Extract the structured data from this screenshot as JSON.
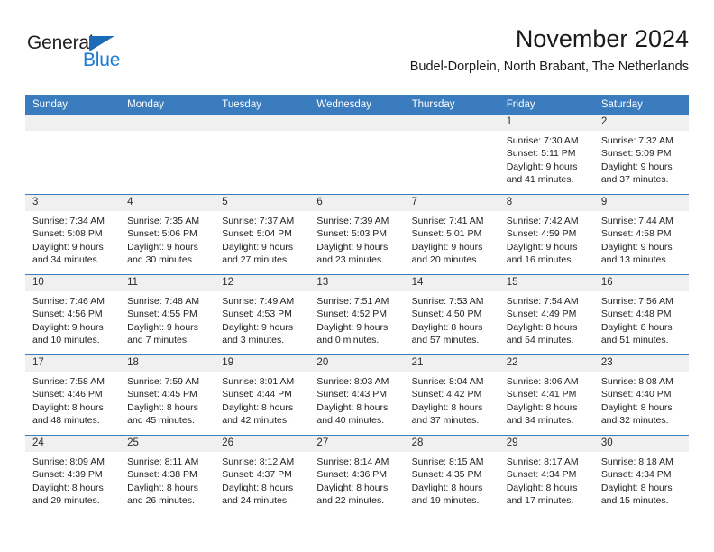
{
  "logo": {
    "word_top": "General",
    "word_bottom": "Blue",
    "triangle_icon": "blue-triangle-icon",
    "color_dark": "#231f20",
    "color_blue": "#1b7ad4"
  },
  "header": {
    "title": "November 2024",
    "subtitle": "Budel-Dorplein, North Brabant, The Netherlands"
  },
  "theme": {
    "header_row_bg": "#3a7cbe",
    "header_row_text": "#ffffff",
    "daynum_band_bg": "#f0f0f0",
    "row_divider": "#3a7cbe"
  },
  "calendar": {
    "weekday_headers": [
      "Sunday",
      "Monday",
      "Tuesday",
      "Wednesday",
      "Thursday",
      "Friday",
      "Saturday"
    ],
    "weeks": [
      [
        {
          "day": "",
          "lines": []
        },
        {
          "day": "",
          "lines": []
        },
        {
          "day": "",
          "lines": []
        },
        {
          "day": "",
          "lines": []
        },
        {
          "day": "",
          "lines": []
        },
        {
          "day": "1",
          "lines": [
            "Sunrise: 7:30 AM",
            "Sunset: 5:11 PM",
            "Daylight: 9 hours",
            "and 41 minutes."
          ]
        },
        {
          "day": "2",
          "lines": [
            "Sunrise: 7:32 AM",
            "Sunset: 5:09 PM",
            "Daylight: 9 hours",
            "and 37 minutes."
          ]
        }
      ],
      [
        {
          "day": "3",
          "lines": [
            "Sunrise: 7:34 AM",
            "Sunset: 5:08 PM",
            "Daylight: 9 hours",
            "and 34 minutes."
          ]
        },
        {
          "day": "4",
          "lines": [
            "Sunrise: 7:35 AM",
            "Sunset: 5:06 PM",
            "Daylight: 9 hours",
            "and 30 minutes."
          ]
        },
        {
          "day": "5",
          "lines": [
            "Sunrise: 7:37 AM",
            "Sunset: 5:04 PM",
            "Daylight: 9 hours",
            "and 27 minutes."
          ]
        },
        {
          "day": "6",
          "lines": [
            "Sunrise: 7:39 AM",
            "Sunset: 5:03 PM",
            "Daylight: 9 hours",
            "and 23 minutes."
          ]
        },
        {
          "day": "7",
          "lines": [
            "Sunrise: 7:41 AM",
            "Sunset: 5:01 PM",
            "Daylight: 9 hours",
            "and 20 minutes."
          ]
        },
        {
          "day": "8",
          "lines": [
            "Sunrise: 7:42 AM",
            "Sunset: 4:59 PM",
            "Daylight: 9 hours",
            "and 16 minutes."
          ]
        },
        {
          "day": "9",
          "lines": [
            "Sunrise: 7:44 AM",
            "Sunset: 4:58 PM",
            "Daylight: 9 hours",
            "and 13 minutes."
          ]
        }
      ],
      [
        {
          "day": "10",
          "lines": [
            "Sunrise: 7:46 AM",
            "Sunset: 4:56 PM",
            "Daylight: 9 hours",
            "and 10 minutes."
          ]
        },
        {
          "day": "11",
          "lines": [
            "Sunrise: 7:48 AM",
            "Sunset: 4:55 PM",
            "Daylight: 9 hours",
            "and 7 minutes."
          ]
        },
        {
          "day": "12",
          "lines": [
            "Sunrise: 7:49 AM",
            "Sunset: 4:53 PM",
            "Daylight: 9 hours",
            "and 3 minutes."
          ]
        },
        {
          "day": "13",
          "lines": [
            "Sunrise: 7:51 AM",
            "Sunset: 4:52 PM",
            "Daylight: 9 hours",
            "and 0 minutes."
          ]
        },
        {
          "day": "14",
          "lines": [
            "Sunrise: 7:53 AM",
            "Sunset: 4:50 PM",
            "Daylight: 8 hours",
            "and 57 minutes."
          ]
        },
        {
          "day": "15",
          "lines": [
            "Sunrise: 7:54 AM",
            "Sunset: 4:49 PM",
            "Daylight: 8 hours",
            "and 54 minutes."
          ]
        },
        {
          "day": "16",
          "lines": [
            "Sunrise: 7:56 AM",
            "Sunset: 4:48 PM",
            "Daylight: 8 hours",
            "and 51 minutes."
          ]
        }
      ],
      [
        {
          "day": "17",
          "lines": [
            "Sunrise: 7:58 AM",
            "Sunset: 4:46 PM",
            "Daylight: 8 hours",
            "and 48 minutes."
          ]
        },
        {
          "day": "18",
          "lines": [
            "Sunrise: 7:59 AM",
            "Sunset: 4:45 PM",
            "Daylight: 8 hours",
            "and 45 minutes."
          ]
        },
        {
          "day": "19",
          "lines": [
            "Sunrise: 8:01 AM",
            "Sunset: 4:44 PM",
            "Daylight: 8 hours",
            "and 42 minutes."
          ]
        },
        {
          "day": "20",
          "lines": [
            "Sunrise: 8:03 AM",
            "Sunset: 4:43 PM",
            "Daylight: 8 hours",
            "and 40 minutes."
          ]
        },
        {
          "day": "21",
          "lines": [
            "Sunrise: 8:04 AM",
            "Sunset: 4:42 PM",
            "Daylight: 8 hours",
            "and 37 minutes."
          ]
        },
        {
          "day": "22",
          "lines": [
            "Sunrise: 8:06 AM",
            "Sunset: 4:41 PM",
            "Daylight: 8 hours",
            "and 34 minutes."
          ]
        },
        {
          "day": "23",
          "lines": [
            "Sunrise: 8:08 AM",
            "Sunset: 4:40 PM",
            "Daylight: 8 hours",
            "and 32 minutes."
          ]
        }
      ],
      [
        {
          "day": "24",
          "lines": [
            "Sunrise: 8:09 AM",
            "Sunset: 4:39 PM",
            "Daylight: 8 hours",
            "and 29 minutes."
          ]
        },
        {
          "day": "25",
          "lines": [
            "Sunrise: 8:11 AM",
            "Sunset: 4:38 PM",
            "Daylight: 8 hours",
            "and 26 minutes."
          ]
        },
        {
          "day": "26",
          "lines": [
            "Sunrise: 8:12 AM",
            "Sunset: 4:37 PM",
            "Daylight: 8 hours",
            "and 24 minutes."
          ]
        },
        {
          "day": "27",
          "lines": [
            "Sunrise: 8:14 AM",
            "Sunset: 4:36 PM",
            "Daylight: 8 hours",
            "and 22 minutes."
          ]
        },
        {
          "day": "28",
          "lines": [
            "Sunrise: 8:15 AM",
            "Sunset: 4:35 PM",
            "Daylight: 8 hours",
            "and 19 minutes."
          ]
        },
        {
          "day": "29",
          "lines": [
            "Sunrise: 8:17 AM",
            "Sunset: 4:34 PM",
            "Daylight: 8 hours",
            "and 17 minutes."
          ]
        },
        {
          "day": "30",
          "lines": [
            "Sunrise: 8:18 AM",
            "Sunset: 4:34 PM",
            "Daylight: 8 hours",
            "and 15 minutes."
          ]
        }
      ]
    ]
  }
}
